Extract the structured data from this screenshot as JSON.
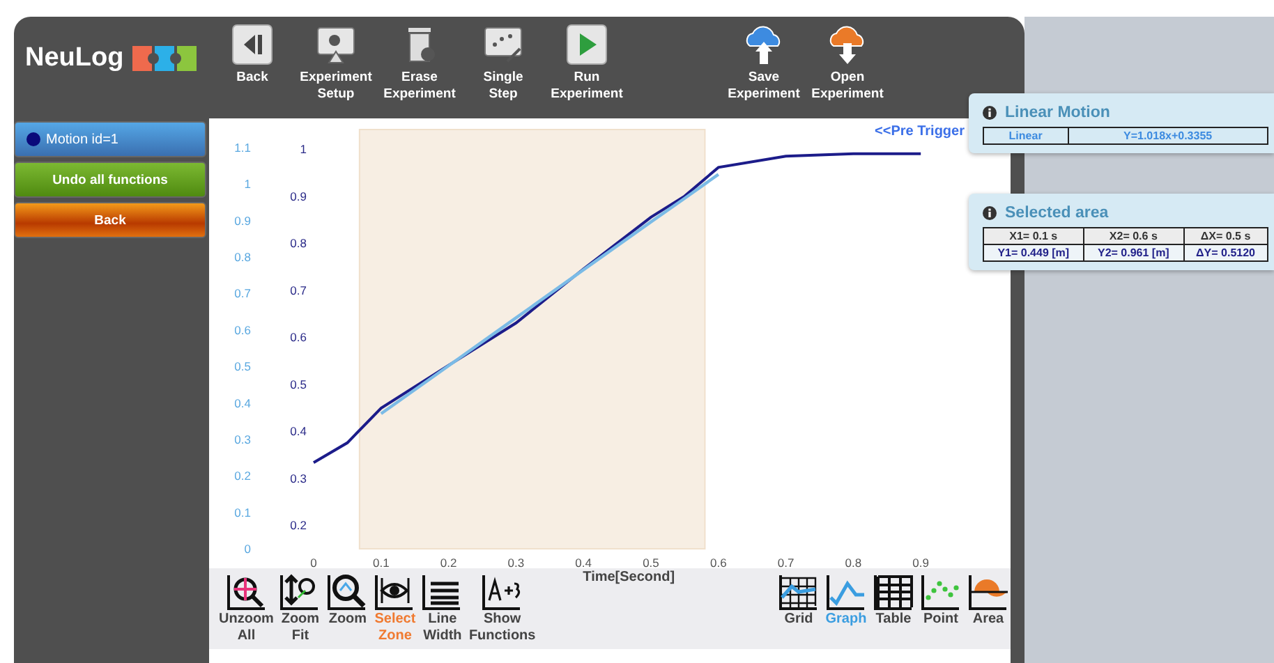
{
  "header": {
    "logo": "NeuLog",
    "tools": [
      {
        "label": "Back",
        "kind": "back"
      },
      {
        "label": "Experiment\nSetup",
        "kind": "setup"
      },
      {
        "label": "Erase\nExperiment",
        "kind": "erase"
      },
      {
        "label": "Single\nStep",
        "kind": "step"
      },
      {
        "label": "Run\nExperiment",
        "kind": "run"
      }
    ],
    "file_tools": [
      {
        "label": "Save\nExperiment",
        "kind": "save"
      },
      {
        "label": "Open\nExperiment",
        "kind": "open"
      }
    ]
  },
  "sidebar": {
    "sensor": {
      "label": "Motion id=1",
      "color": "#0a0a7a"
    },
    "buttons": [
      {
        "label": "Undo all functions",
        "kind": "green"
      },
      {
        "label": "Back",
        "kind": "orange"
      }
    ]
  },
  "graph": {
    "pre_trigger": "<<Pre Trigger",
    "chart_data": {
      "type": "line",
      "xlabel": "Time[Second]",
      "xlim": [
        0,
        0.9
      ],
      "ylim": [
        0.2,
        1
      ],
      "y2lim": [
        0,
        1.1
      ],
      "x": [
        0,
        0.05,
        0.1,
        0.2,
        0.3,
        0.4,
        0.5,
        0.55,
        0.6,
        0.7,
        0.8,
        0.9
      ],
      "xticks": [
        0,
        0.1,
        0.2,
        0.3,
        0.4,
        0.5,
        0.6,
        0.7,
        0.8,
        0.9
      ],
      "yticks": [
        0.2,
        0.3,
        0.4,
        0.5,
        0.6,
        0.7,
        0.8,
        0.9,
        1
      ],
      "y2ticks": [
        0,
        0.1,
        0.2,
        0.3,
        0.4,
        0.5,
        0.6,
        0.7,
        0.8,
        0.9,
        1,
        1.1
      ],
      "series": [
        {
          "color": "#1c1c8a",
          "values": [
            0.333,
            0.375,
            0.449,
            0.54,
            0.63,
            0.745,
            0.855,
            0.9,
            0.961,
            0.985,
            0.99,
            0.99
          ]
        },
        {
          "color": "#7bbbe6",
          "values": [
            null,
            null,
            0.437,
            0.539,
            0.641,
            0.743,
            0.845,
            0.895,
            0.946,
            null,
            null,
            null
          ]
        }
      ]
    }
  },
  "view_tools": [
    {
      "label": "Unzoom\nAll",
      "kind": "unzoom",
      "selected": false
    },
    {
      "label": "Zoom\nFit",
      "kind": "zoomfit",
      "selected": false
    },
    {
      "label": "Zoom",
      "kind": "zoom",
      "selected": false
    },
    {
      "label": "Select\nZone",
      "kind": "select",
      "selected": true
    },
    {
      "label": "Line\nWidth",
      "kind": "linewidth",
      "selected": false
    },
    {
      "label": "Show\nFunctions",
      "kind": "functions",
      "selected": false
    }
  ],
  "display_tools": [
    {
      "label": "Grid",
      "kind": "grid",
      "selected": false
    },
    {
      "label": "Graph",
      "kind": "graph",
      "selected": true
    },
    {
      "label": "Table",
      "kind": "table",
      "selected": false
    },
    {
      "label": "Point",
      "kind": "point",
      "selected": false
    },
    {
      "label": "Area",
      "kind": "area",
      "selected": false
    }
  ],
  "linear_motion": {
    "title": "Linear Motion",
    "cells": [
      "Linear",
      "Y=1.018x+0.3355"
    ]
  },
  "selected_area": {
    "title": "Selected area",
    "rows": [
      [
        "X1= 0.1 s",
        "X2= 0.6 s",
        "ΔX= 0.5 s"
      ],
      [
        "Y1= 0.449 [m]",
        "Y2= 0.961 [m]",
        "ΔY= 0.5120"
      ]
    ]
  }
}
